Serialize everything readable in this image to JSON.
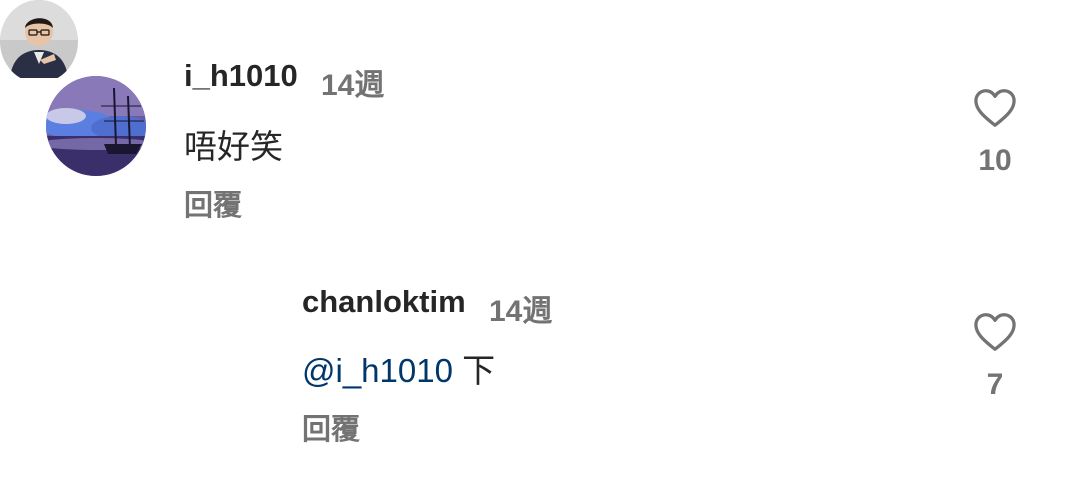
{
  "comments": [
    {
      "username": "i_h1010",
      "time": "14週",
      "text": "唔好笑",
      "reply_label": "回覆",
      "likes": "10",
      "avatar_icon": "sailing-ship-painting-avatar"
    },
    {
      "username": "chanloktim",
      "time": "14週",
      "mention": "@i_h1010",
      "text_after_mention": "下",
      "reply_label": "回覆",
      "likes": "7",
      "avatar_icon": "person-avatar-with-story-ring"
    }
  ],
  "colors": {
    "text_primary": "#262626",
    "text_secondary": "#737373",
    "mention": "#00376b"
  }
}
